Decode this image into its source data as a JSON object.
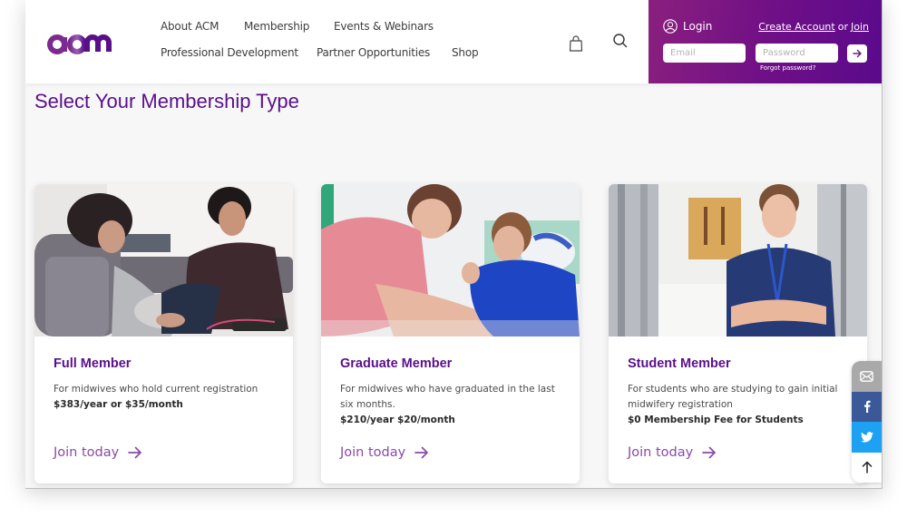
{
  "brand": {
    "logo_text": "acm",
    "primary_color": "#5a0f8a",
    "accent_color": "#8b4aa8"
  },
  "nav": {
    "items": [
      {
        "label": "About ACM"
      },
      {
        "label": "Membership"
      },
      {
        "label": "Events & Webinars"
      },
      {
        "label": "Professional Development"
      },
      {
        "label": "Partner Opportunities"
      },
      {
        "label": "Shop"
      }
    ],
    "cart_icon": "shopping-bag-icon",
    "search_icon": "search-icon"
  },
  "login": {
    "label": "Login",
    "create_account": "Create Account",
    "or": "or",
    "join": "Join",
    "email_placeholder": "Email",
    "password_placeholder": "Password",
    "forgot_password": "Forgot password?",
    "submit_icon": "arrow-right-icon"
  },
  "page": {
    "title": "Select Your Membership Type"
  },
  "cards": [
    {
      "title": "Full Member",
      "description": "For midwives who hold current registration",
      "price": "$383/year or $35/month",
      "cta": "Join today",
      "image_alt": "Midwife examining pregnant woman on sofa"
    },
    {
      "title": "Graduate Member",
      "description": "For midwives who have graduated in the last six months.",
      "price": "$210/year $20/month",
      "cta": "Join today",
      "image_alt": "Midwife in pink scrubs assisting pregnant woman"
    },
    {
      "title": "Student Member",
      "description": "For students who are studying to gain initial midwifery registration",
      "price": "$0 Membership Fee for Students",
      "cta": "Join today",
      "image_alt": "Smiling student in navy scrubs in hospital corridor"
    }
  ],
  "share": {
    "items": [
      {
        "icon": "email-icon",
        "color": "#a9a9a9"
      },
      {
        "icon": "facebook-icon",
        "color": "#3b5998"
      },
      {
        "icon": "twitter-icon",
        "color": "#1da1f2"
      },
      {
        "icon": "back-to-top-icon",
        "color": "#ffffff"
      }
    ]
  }
}
